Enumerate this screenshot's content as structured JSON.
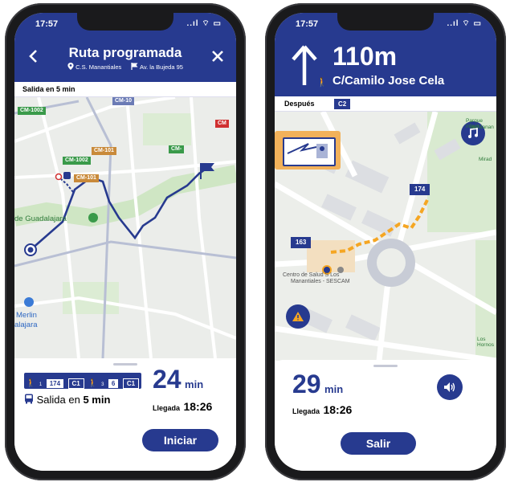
{
  "left": {
    "status": {
      "time": "17:57",
      "icons": "..ıl ⌔ ▭"
    },
    "header": {
      "back_icon": "chevron-left-icon",
      "title": "Ruta programada",
      "origin": "C.S. Manantiales",
      "destination": "Av. la Bujeda 95",
      "close_icon": "close-icon"
    },
    "subheader": "Salida en 5 min",
    "map": {
      "road_labels": [
        "CM-1002",
        "CM-10",
        "CM-101",
        "CM-1002",
        "CM-101",
        "CM-",
        "CM"
      ],
      "place_labels": [
        "de Guadalajara",
        "Merlin",
        "alajara"
      ]
    },
    "sheet": {
      "legs": [
        "174",
        "C1",
        "6",
        "C1"
      ],
      "walk_steps": [
        "1",
        "3"
      ],
      "departure_prefix": "Salida en",
      "departure_value": "5 min",
      "duration_value": "24",
      "duration_unit": "min",
      "arrival_label": "Llegada",
      "arrival_time": "18:26",
      "start_button": "Iniciar"
    }
  },
  "right": {
    "status": {
      "time": "17:57",
      "icons": "..ıl ⌔ ▭"
    },
    "nav": {
      "distance": "110m",
      "street": "C/Camilo Jose Cela",
      "arrow_icon": "arrow-up-icon",
      "walk_icon": "walk-icon"
    },
    "next_bar": {
      "label": "Después",
      "route": "C2"
    },
    "map": {
      "stop_labels": [
        "174",
        "163"
      ],
      "place_label_line1": "Centro de Salud S Los",
      "place_label_line2": "Manantiales - SESCAM",
      "edge_labels": [
        "Parque infant",
        "de Manan",
        "Mirad",
        "Los Hornos"
      ]
    },
    "sheet": {
      "duration_value": "29",
      "duration_unit": "min",
      "arrival_label": "Llegada",
      "arrival_time": "18:26",
      "exit_button": "Salir",
      "sound_icon": "speaker-icon"
    }
  },
  "colors": {
    "brand": "#273a8f",
    "route_orange": "#f5a623",
    "map_bg": "#eceeea",
    "park": "#cfe6c4"
  }
}
